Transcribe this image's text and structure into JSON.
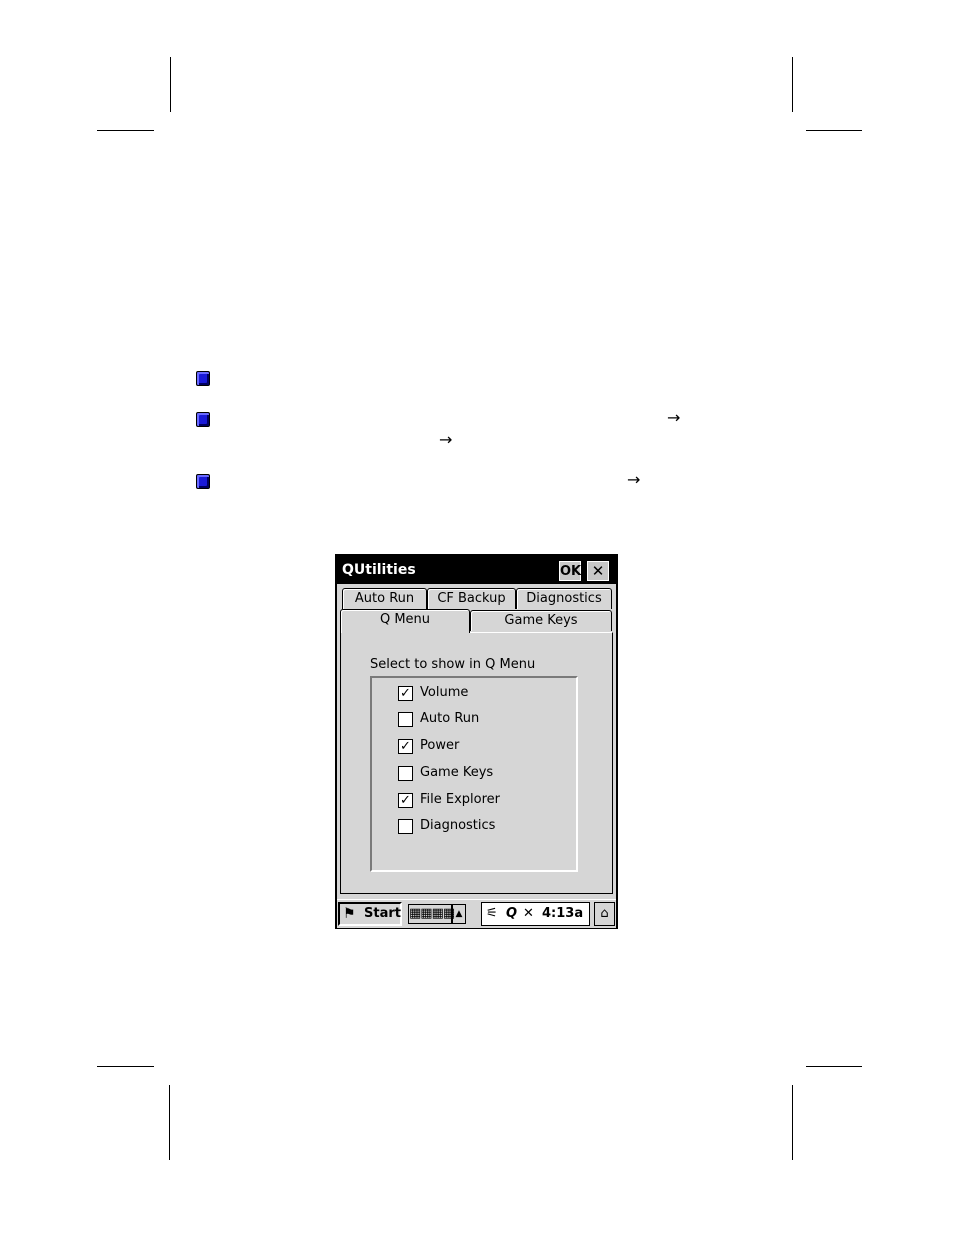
{
  "window": {
    "title": "QUtilities",
    "ok_label": "OK",
    "close_label": "✕"
  },
  "tabs": {
    "row1": [
      "Auto Run",
      "CF Backup",
      "Diagnostics"
    ],
    "row2": [
      "Q Menu",
      "Game Keys"
    ],
    "active": "Q Menu"
  },
  "panel": {
    "label": "Select to show in Q Menu",
    "items": [
      {
        "label": "Volume",
        "checked": true
      },
      {
        "label": "Auto Run",
        "checked": false
      },
      {
        "label": "Power",
        "checked": true
      },
      {
        "label": "Game Keys",
        "checked": false
      },
      {
        "label": "File Explorer",
        "checked": true
      },
      {
        "label": "Diagnostics",
        "checked": false
      }
    ]
  },
  "taskbar": {
    "start_label": "Start",
    "keyboard_icon": "keyboard-icon",
    "time": "4:13a"
  },
  "page": {
    "arrow_glyph": "→"
  }
}
